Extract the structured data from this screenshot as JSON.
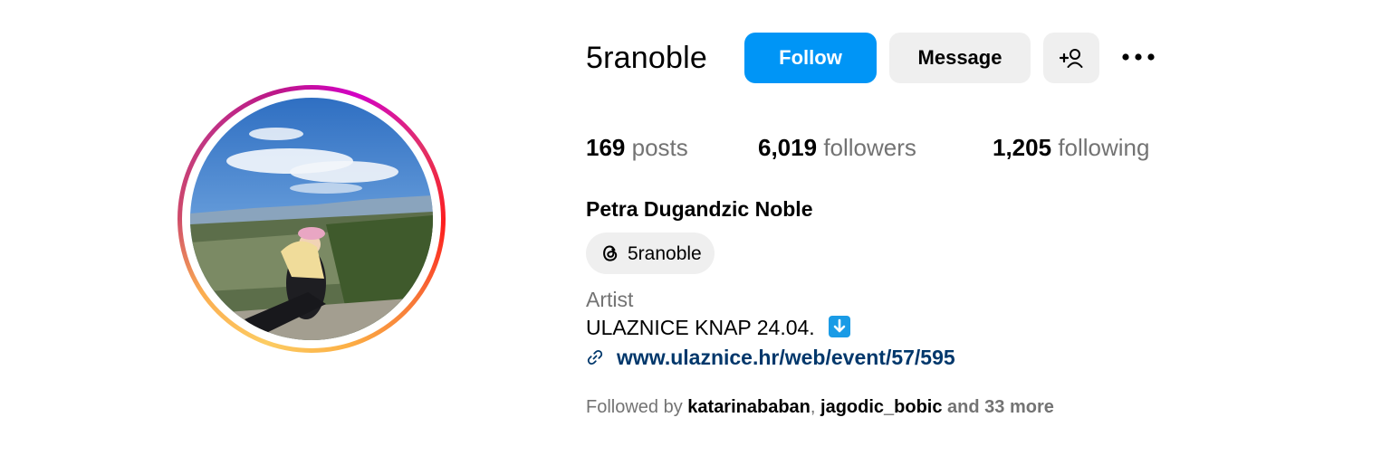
{
  "profile": {
    "username": "5ranoble",
    "full_name": "Petra Dugandzic Noble",
    "category": "Artist",
    "bio_line": "ULAZNICE KNAP 24.04.",
    "bio_emoji": "down-arrow-button",
    "link": "www.ulaznice.hr/web/event/57/595",
    "threads_handle": "5ranoble"
  },
  "actions": {
    "follow_label": "Follow",
    "message_label": "Message"
  },
  "stats": {
    "posts_count": "169",
    "posts_label": "posts",
    "followers_count": "6,019",
    "followers_label": "followers",
    "following_count": "1,205",
    "following_label": "following"
  },
  "followed_by": {
    "prefix": "Followed by",
    "user1": "katarinababan",
    "separator": ",",
    "user2": "jagodic_bobic",
    "suffix": "and 33 more"
  },
  "colors": {
    "follow_button": "#0095f6",
    "secondary_button": "#efefef",
    "muted_text": "#737373",
    "link_text": "#00376b"
  },
  "icons": {
    "add_person": "add-person-icon",
    "more": "more-options-icon",
    "threads": "threads-icon",
    "link": "link-icon"
  }
}
